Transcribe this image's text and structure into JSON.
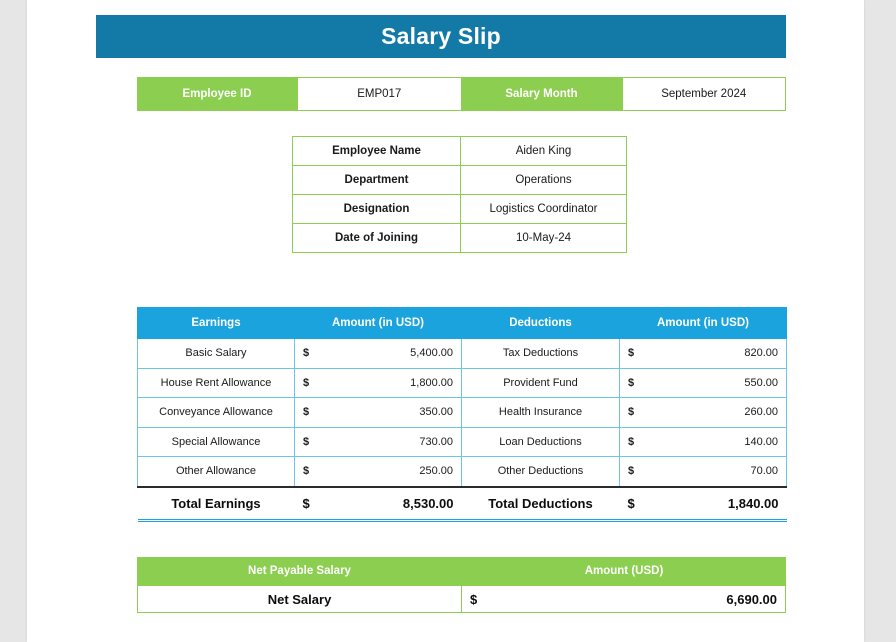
{
  "document": {
    "title": "Salary Slip"
  },
  "identity": {
    "employee_id_label": "Employee ID",
    "employee_id_value": "EMP017",
    "salary_month_label": "Salary Month",
    "salary_month_value": "September 2024"
  },
  "employee_details": {
    "rows": [
      {
        "label": "Employee Name",
        "value": "Aiden King"
      },
      {
        "label": "Department",
        "value": "Operations"
      },
      {
        "label": "Designation",
        "value": "Logistics Coordinator"
      },
      {
        "label": "Date of Joining",
        "value": "10-May-24"
      }
    ]
  },
  "earnings_deductions": {
    "headers": {
      "earnings": "Earnings",
      "earnings_amount": "Amount (in USD)",
      "deductions": "Deductions",
      "deductions_amount": "Amount (in USD)"
    },
    "currency_symbol": "$",
    "rows": [
      {
        "earning": "Basic Salary",
        "earning_amount": "5,400.00",
        "deduction": "Tax Deductions",
        "deduction_amount": "820.00"
      },
      {
        "earning": "House Rent Allowance",
        "earning_amount": "1,800.00",
        "deduction": "Provident Fund",
        "deduction_amount": "550.00"
      },
      {
        "earning": "Conveyance Allowance",
        "earning_amount": "350.00",
        "deduction": "Health Insurance",
        "deduction_amount": "260.00"
      },
      {
        "earning": "Special Allowance",
        "earning_amount": "730.00",
        "deduction": "Loan Deductions",
        "deduction_amount": "140.00"
      },
      {
        "earning": "Other Allowance",
        "earning_amount": "250.00",
        "deduction": "Other Deductions",
        "deduction_amount": "70.00"
      }
    ],
    "totals": {
      "earnings_label": "Total Earnings",
      "earnings_amount": "8,530.00",
      "deductions_label": "Total Deductions",
      "deductions_amount": "1,840.00"
    }
  },
  "net_payable": {
    "header_label": "Net Payable Salary",
    "header_amount": "Amount (USD)",
    "row_label": "Net Salary",
    "currency_symbol": "$",
    "row_amount": "6,690.00"
  },
  "colors": {
    "banner_blue": "#1379a7",
    "table_header_blue": "#1ba3dd",
    "cell_border_blue": "#6dc6e8",
    "green": "#8cce4f",
    "page_background": "#ffffff",
    "canvas_background": "#e6e6e6"
  }
}
